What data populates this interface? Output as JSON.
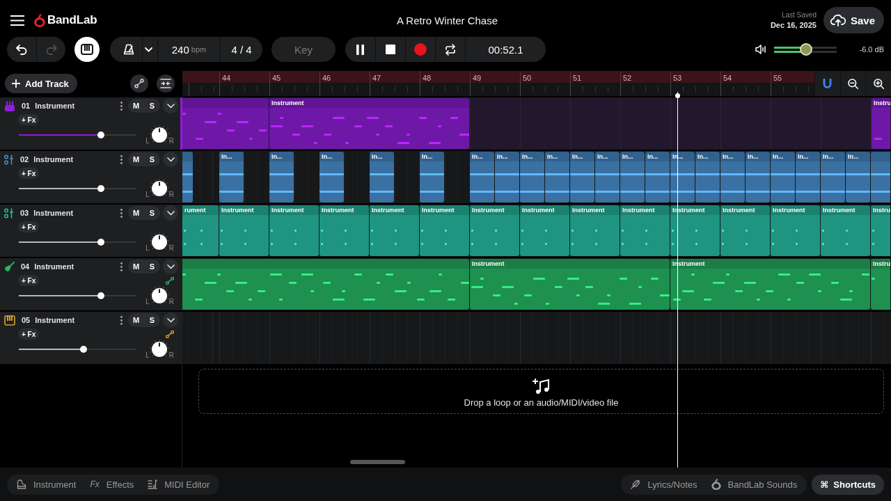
{
  "header": {
    "app_name": "BandLab",
    "title": "A Retro Winter Chase",
    "last_saved_label": "Last Saved",
    "last_saved_date": "Dec 16, 2025",
    "save_label": "Save"
  },
  "toolbar": {
    "undo": {
      "disabled": false
    },
    "redo": {
      "disabled": true
    },
    "keyboard": {
      "on": true
    },
    "tempo": "240",
    "tempo_unit": "bpm",
    "time_signature": "4 / 4",
    "key_label": "Key",
    "playing": true,
    "time": "00:52.1",
    "volume": {
      "level": 0.52,
      "reading": "-6.0 dB"
    }
  },
  "timeline": {
    "add_track_label": "Add Track",
    "snap_on": true,
    "bars": [
      "44",
      "45",
      "46",
      "47",
      "48",
      "49",
      "50",
      "51",
      "52",
      "53",
      "54",
      "55"
    ]
  },
  "tracks": [
    {
      "number": "01",
      "name": "Instrument",
      "kind": "drums",
      "color": "#8d1fd6",
      "selected": true,
      "mute_label": "M",
      "solo_label": "S",
      "fx_label": "+ Fx",
      "automation": false,
      "level": 0.7,
      "pan_left": "L",
      "pan_right": "R",
      "clips": [
        {
          "kind": "cut_left"
        },
        {
          "kind": "whole",
          "label": "Instrument"
        },
        {
          "kind": "cut_right",
          "label": "Instru"
        }
      ]
    },
    {
      "number": "02",
      "name": "Instrument",
      "kind": "synth",
      "color": "#4a8fd0",
      "selected": false,
      "mute_label": "M",
      "solo_label": "S",
      "fx_label": "+ Fx",
      "automation": false,
      "level": 0.7,
      "pan_left": "L",
      "pan_right": "R",
      "clips": [
        {
          "kind": "cut_left"
        },
        {
          "kind": "whole",
          "label": "In..."
        },
        {
          "kind": "whole",
          "label": "In..."
        },
        {
          "kind": "whole",
          "label": "In..."
        },
        {
          "kind": "whole",
          "label": "In..."
        },
        {
          "kind": "whole",
          "label": "In..."
        },
        {
          "kind": "whole",
          "label": "In..."
        },
        {
          "kind": "whole",
          "label": "In..."
        },
        {
          "kind": "whole",
          "label": "In..."
        },
        {
          "kind": "whole",
          "label": "In..."
        },
        {
          "kind": "whole",
          "label": "In..."
        },
        {
          "kind": "whole",
          "label": "In..."
        },
        {
          "kind": "whole",
          "label": "In..."
        },
        {
          "kind": "whole",
          "label": "In..."
        },
        {
          "kind": "whole",
          "label": "In..."
        },
        {
          "kind": "whole",
          "label": "In..."
        },
        {
          "kind": "whole",
          "label": "In..."
        },
        {
          "kind": "whole",
          "label": "In..."
        },
        {
          "kind": "whole",
          "label": "In..."
        },
        {
          "kind": "whole",
          "label": "In..."
        },
        {
          "kind": "whole",
          "label": "In..."
        },
        {
          "kind": "whole",
          "label": "In..."
        },
        {
          "kind": "cut_right"
        }
      ]
    },
    {
      "number": "03",
      "name": "Instrument",
      "kind": "synth",
      "color": "#28bfa6",
      "selected": false,
      "mute_label": "M",
      "solo_label": "S",
      "fx_label": "+ Fx",
      "automation": false,
      "level": 0.7,
      "pan_left": "L",
      "pan_right": "R",
      "clips": [
        {
          "kind": "cut_left",
          "label": "rument"
        },
        {
          "kind": "whole",
          "label": "Instrument"
        },
        {
          "kind": "whole",
          "label": "Instrument"
        },
        {
          "kind": "whole",
          "label": "Instrument"
        },
        {
          "kind": "whole",
          "label": "Instrument"
        },
        {
          "kind": "whole",
          "label": "Instrument"
        },
        {
          "kind": "whole",
          "label": "Instrument"
        },
        {
          "kind": "whole",
          "label": "Instrument"
        },
        {
          "kind": "whole",
          "label": "Instrument"
        },
        {
          "kind": "whole",
          "label": "Instrument"
        },
        {
          "kind": "whole",
          "label": "Instrument"
        },
        {
          "kind": "whole",
          "label": "Instrument"
        },
        {
          "kind": "whole",
          "label": "Instrument"
        },
        {
          "kind": "whole",
          "label": "Instrument"
        },
        {
          "kind": "cut_right",
          "label": "Instru"
        }
      ]
    },
    {
      "number": "04",
      "name": "Instrument",
      "kind": "guitar",
      "color": "#27b865",
      "selected": false,
      "mute_label": "M",
      "solo_label": "S",
      "fx_label": "+ Fx",
      "automation": true,
      "level": 0.7,
      "pan_left": "L",
      "pan_right": "R",
      "clips": [
        {
          "kind": "cut_left"
        },
        {
          "kind": "whole",
          "label": "Instrument"
        },
        {
          "kind": "whole",
          "label": "Instrument"
        },
        {
          "kind": "cut_right",
          "label": "Instru"
        }
      ]
    },
    {
      "number": "05",
      "name": "Instrument",
      "kind": "keys",
      "color": "#d9a12b",
      "selected": false,
      "mute_label": "M",
      "solo_label": "S",
      "fx_label": "+ Fx",
      "automation": true,
      "level": 0.55,
      "pan_left": "L",
      "pan_right": "R"
    }
  ],
  "drop_zone": {
    "text": "Drop a loop or an audio/MIDI/video file"
  },
  "bottom_bar": {
    "left": [
      {
        "kind": "instrument",
        "label": "Instrument"
      },
      {
        "kind": "effects",
        "glyph": "Fx",
        "label": "Effects"
      },
      {
        "kind": "midi_editor",
        "label": "MIDI Editor"
      }
    ],
    "right": [
      {
        "kind": "lyrics",
        "label": "Lyrics/Notes"
      },
      {
        "kind": "sounds",
        "label": "BandLab Sounds"
      }
    ],
    "shortcuts": {
      "glyph": "⌘",
      "label": "Shortcuts"
    }
  }
}
